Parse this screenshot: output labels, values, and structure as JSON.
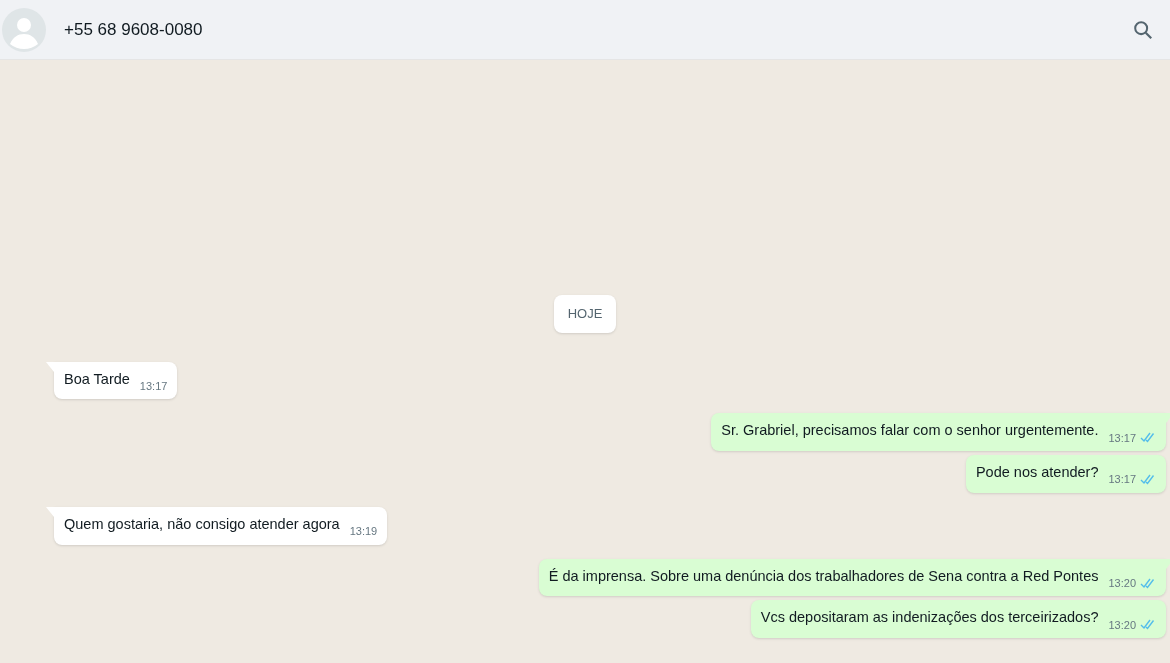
{
  "header": {
    "contact": "+55 68 9608-0080"
  },
  "messages": [
    {
      "kind": "date",
      "text": "HOJE"
    },
    {
      "kind": "in",
      "tail": true,
      "text": "Boa Tarde",
      "time": "13:17"
    },
    {
      "kind": "out",
      "tail": true,
      "text": "Sr. Grabriel, precisamos falar com o senhor urgentemente.",
      "time": "13:17",
      "read": true
    },
    {
      "kind": "out",
      "tail": false,
      "text": "Pode nos atender?",
      "time": "13:17",
      "read": true
    },
    {
      "kind": "in",
      "tail": true,
      "text": "Quem gostaria, não consigo atender agora",
      "time": "13:19"
    },
    {
      "kind": "out",
      "tail": true,
      "text": "É da imprensa. Sobre uma denúncia dos trabalhadores de Sena contra a Red Pontes",
      "time": "13:20",
      "read": true
    },
    {
      "kind": "out",
      "tail": false,
      "text": "Vcs depositaram as indenizações dos terceirizados?",
      "time": "13:20",
      "read": true
    }
  ]
}
